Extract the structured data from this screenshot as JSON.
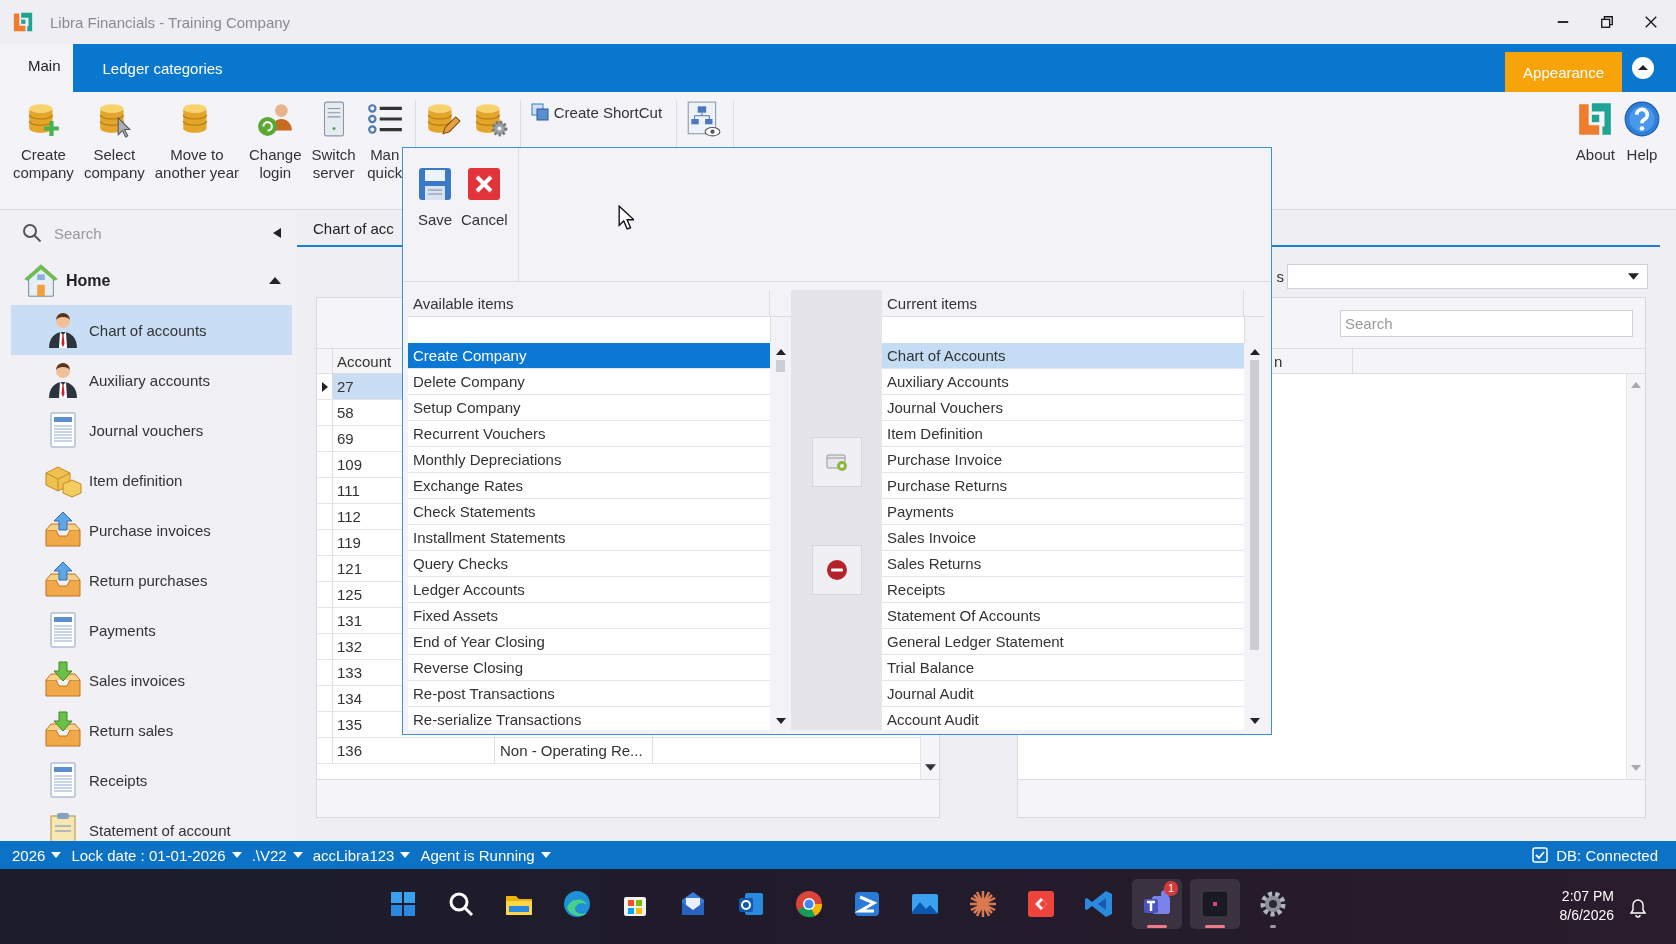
{
  "window": {
    "title": "Libra Financials - Training Company"
  },
  "ribbon": {
    "tabs": [
      {
        "label": "Main",
        "selected": true
      },
      {
        "label": "Ledger categories",
        "selected": false
      }
    ],
    "appearance": "Appearance",
    "groups": [
      {
        "buttons": [
          {
            "kind": "large",
            "lines": [
              "Create",
              "company"
            ]
          },
          {
            "kind": "large",
            "lines": [
              "Select",
              "company"
            ]
          },
          {
            "kind": "large",
            "lines": [
              "Move to",
              "another year"
            ]
          },
          {
            "kind": "large",
            "lines": [
              "Change",
              "login"
            ]
          },
          {
            "kind": "large",
            "lines": [
              "Switch",
              "server"
            ]
          },
          {
            "kind": "large",
            "lines": [
              "Man",
              "quick"
            ]
          }
        ]
      },
      {
        "buttons": [
          {
            "kind": "icon"
          },
          {
            "kind": "icon"
          }
        ]
      },
      {
        "buttons": [
          {
            "kind": "small",
            "lines": [
              "Create ShortCut"
            ]
          }
        ]
      },
      {
        "buttons": [
          {
            "kind": "icon"
          }
        ]
      }
    ],
    "right_buttons": [
      {
        "kind": "large",
        "lines": [
          "About"
        ]
      },
      {
        "kind": "large",
        "lines": [
          "Help"
        ]
      }
    ]
  },
  "sidebar": {
    "search": {
      "placeholder": "Search"
    },
    "home": {
      "label": "Home",
      "expanded": true
    },
    "items": [
      {
        "label": "Chart of accounts",
        "selected": true
      },
      {
        "label": "Auxiliary accounts",
        "selected": false
      },
      {
        "label": "Journal vouchers",
        "selected": false
      },
      {
        "label": "Item definition",
        "selected": false
      },
      {
        "label": "Purchase invoices",
        "selected": false
      },
      {
        "label": "Return purchases",
        "selected": false
      },
      {
        "label": "Payments",
        "selected": false
      },
      {
        "label": "Sales invoices",
        "selected": false
      },
      {
        "label": "Return sales",
        "selected": false
      },
      {
        "label": "Receipts",
        "selected": false
      },
      {
        "label": "Statement of account",
        "selected": false
      }
    ]
  },
  "document_tab": {
    "label": "Chart of acc",
    "selected": true
  },
  "accounts_grid": {
    "columns": [
      "Account"
    ],
    "rows": [
      {
        "account": "27",
        "selected": true
      },
      {
        "account": "58",
        "selected": false
      },
      {
        "account": "69",
        "selected": false
      },
      {
        "account": "109",
        "selected": false
      },
      {
        "account": "111",
        "selected": false
      },
      {
        "account": "112",
        "selected": false
      },
      {
        "account": "119",
        "selected": false
      },
      {
        "account": "121",
        "selected": false
      },
      {
        "account": "125",
        "selected": false
      },
      {
        "account": "131",
        "selected": false
      },
      {
        "account": "132",
        "selected": false
      },
      {
        "account": "133",
        "selected": false
      },
      {
        "account": "134",
        "selected": false
      },
      {
        "account": "135",
        "selected": false
      },
      {
        "account": "136",
        "column_2": "Non - Operating Re...",
        "selected": false
      }
    ]
  },
  "right_panel": {
    "filter_label": "s",
    "search": {
      "placeholder": "Search"
    },
    "columns": [
      "n"
    ]
  },
  "dialog": {
    "toolbar": [
      {
        "label": "Save"
      },
      {
        "label": "Cancel"
      }
    ],
    "available": {
      "header": "Available items",
      "items": [
        {
          "label": "Create Company",
          "selected": true
        },
        {
          "label": "Delete Company",
          "selected": false
        },
        {
          "label": "Setup Company",
          "selected": false
        },
        {
          "label": "Recurrent Vouchers",
          "selected": false
        },
        {
          "label": "Monthly Depreciations",
          "selected": false
        },
        {
          "label": "Exchange Rates",
          "selected": false
        },
        {
          "label": "Check Statements",
          "selected": false
        },
        {
          "label": "Installment Statements",
          "selected": false
        },
        {
          "label": "Query Checks",
          "selected": false
        },
        {
          "label": "Ledger Accounts",
          "selected": false
        },
        {
          "label": "Fixed Assets",
          "selected": false
        },
        {
          "label": "End of Year Closing",
          "selected": false
        },
        {
          "label": "Reverse Closing",
          "selected": false
        },
        {
          "label": "Re-post Transactions",
          "selected": false
        },
        {
          "label": "Re-serialize Transactions",
          "selected": false
        }
      ]
    },
    "current": {
      "header": "Current items",
      "items": [
        {
          "label": "Chart of Accounts",
          "selected": true
        },
        {
          "label": "Auxiliary Accounts",
          "selected": false
        },
        {
          "label": "Journal Vouchers",
          "selected": false
        },
        {
          "label": "Item Definition",
          "selected": false
        },
        {
          "label": "Purchase Invoice",
          "selected": false
        },
        {
          "label": "Purchase Returns",
          "selected": false
        },
        {
          "label": "Payments",
          "selected": false
        },
        {
          "label": "Sales Invoice",
          "selected": false
        },
        {
          "label": "Sales Returns",
          "selected": false
        },
        {
          "label": "Receipts",
          "selected": false
        },
        {
          "label": "Statement Of Accounts",
          "selected": false
        },
        {
          "label": "General Ledger Statement",
          "selected": false
        },
        {
          "label": "Trial Balance",
          "selected": false
        },
        {
          "label": "Journal Audit",
          "selected": false
        },
        {
          "label": "Account Audit",
          "selected": false
        }
      ]
    }
  },
  "status_bar": {
    "items": [
      "2026",
      "Lock date : 01-01-2026",
      ".\\V22",
      "accLibra123",
      "Agent is Running"
    ],
    "db": {
      "label": "DB: Connected",
      "checked": true
    }
  },
  "taskbar": {
    "apps": [
      {
        "running": false,
        "focused": false
      },
      {
        "running": false,
        "focused": false
      },
      {
        "running": false,
        "focused": false
      },
      {
        "running": false,
        "focused": false
      },
      {
        "running": false,
        "focused": false
      },
      {
        "running": false,
        "focused": false
      },
      {
        "running": false,
        "focused": false
      },
      {
        "running": false,
        "focused": false
      },
      {
        "running": false,
        "focused": false
      },
      {
        "running": false,
        "focused": false
      },
      {
        "running": false,
        "focused": false
      },
      {
        "running": false,
        "focused": false
      },
      {
        "running": false,
        "focused": false
      },
      {
        "running": true,
        "focused": true,
        "badge": "1"
      },
      {
        "running": true,
        "focused": true
      },
      {
        "running": true,
        "focused": false
      }
    ],
    "time": "2:07 PM",
    "date": "8/6/2026"
  }
}
